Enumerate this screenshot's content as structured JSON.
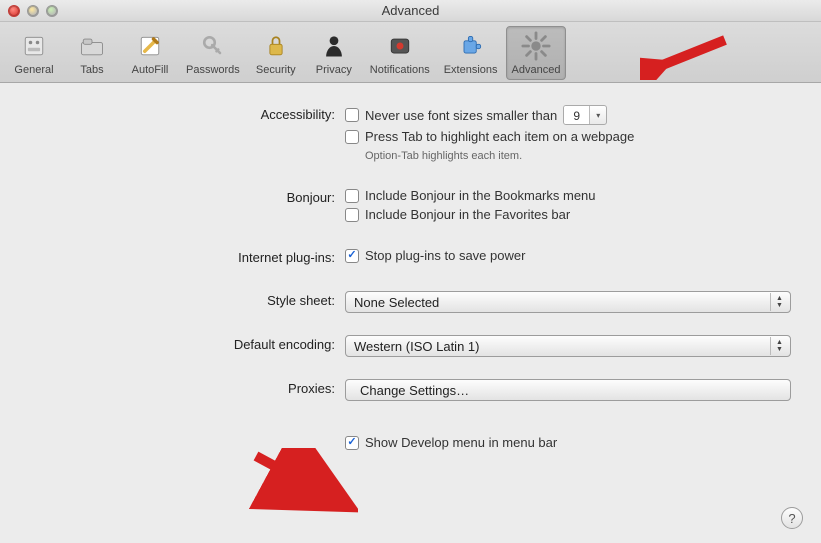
{
  "window": {
    "title": "Advanced"
  },
  "toolbar": {
    "items": [
      {
        "label": "General"
      },
      {
        "label": "Tabs"
      },
      {
        "label": "AutoFill"
      },
      {
        "label": "Passwords"
      },
      {
        "label": "Security"
      },
      {
        "label": "Privacy"
      },
      {
        "label": "Notifications"
      },
      {
        "label": "Extensions"
      },
      {
        "label": "Advanced"
      }
    ]
  },
  "accessibility": {
    "title": "Accessibility:",
    "never_smaller_label": "Never use font sizes smaller than",
    "font_size_value": "9",
    "press_tab_label": "Press Tab to highlight each item on a webpage",
    "option_tab_hint": "Option-Tab highlights each item."
  },
  "bonjour": {
    "title": "Bonjour:",
    "bookmarks_label": "Include Bonjour in the Bookmarks menu",
    "favorites_label": "Include Bonjour in the Favorites bar"
  },
  "plugins": {
    "title": "Internet plug-ins:",
    "stop_label": "Stop plug-ins to save power"
  },
  "stylesheet": {
    "title": "Style sheet:",
    "value": "None Selected"
  },
  "encoding": {
    "title": "Default encoding:",
    "value": "Western (ISO Latin 1)"
  },
  "proxies": {
    "title": "Proxies:",
    "button": "Change Settings…"
  },
  "develop": {
    "label": "Show Develop menu in menu bar"
  },
  "help": {
    "label": "?"
  }
}
